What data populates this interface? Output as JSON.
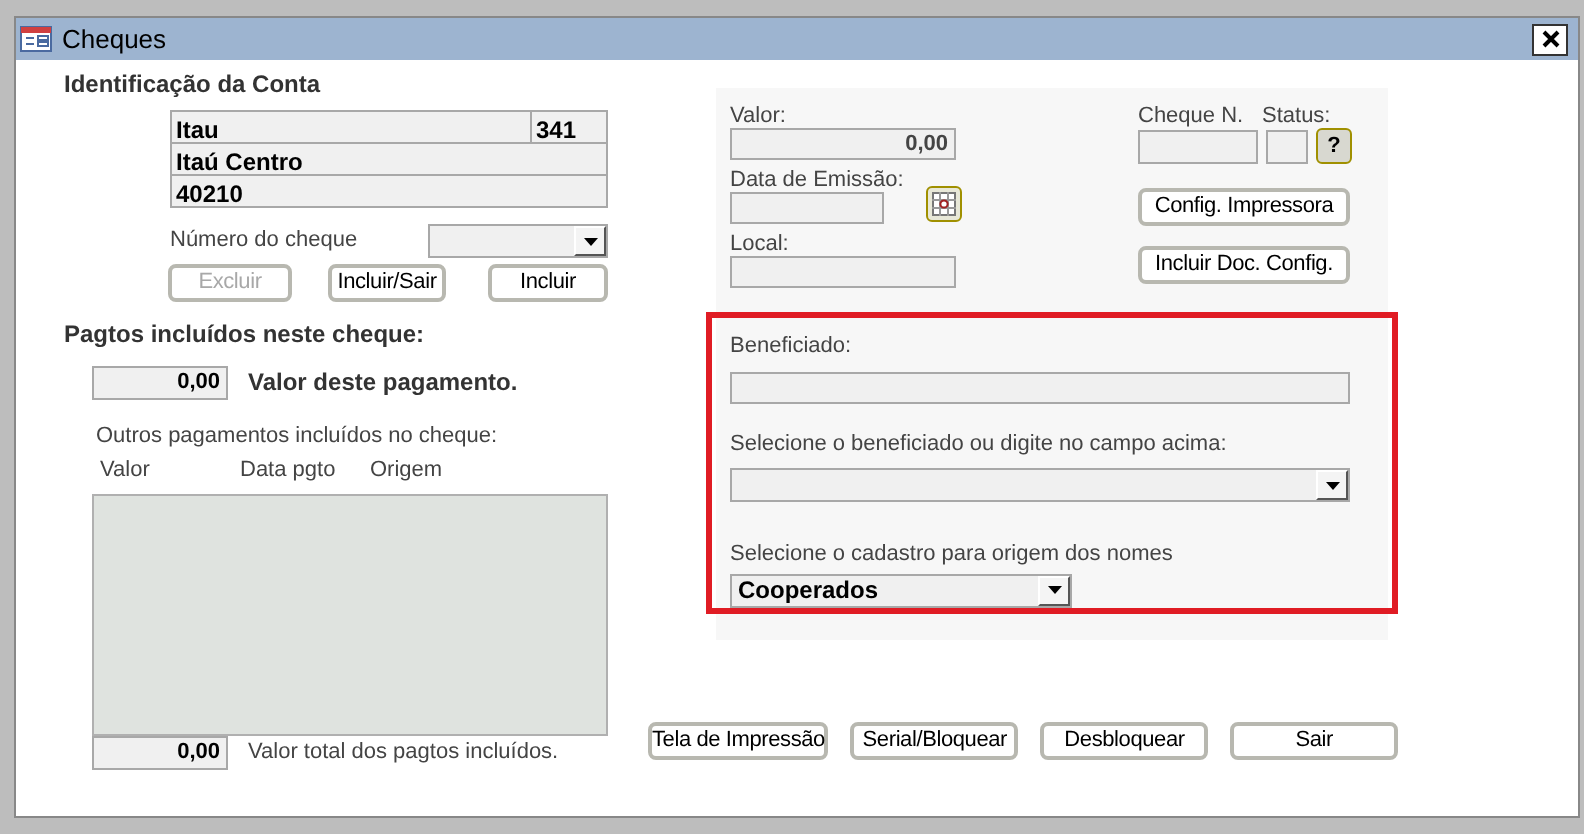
{
  "window": {
    "title": "Cheques"
  },
  "account": {
    "heading": "Identificação da Conta",
    "bank": "Itau",
    "bank_code": "341",
    "branch": "Itaú Centro",
    "account_number": "40210"
  },
  "check_number": {
    "label": "Número do cheque"
  },
  "left_buttons": [
    {
      "label": "Excluir",
      "disabled": true
    },
    {
      "label": "Incluir/Sair",
      "disabled": false
    },
    {
      "label": "Incluir",
      "disabled": false
    }
  ],
  "payments": {
    "heading": "Pagtos incluídos neste cheque:",
    "value": "0,00",
    "value_label": "Valor deste pagamento.",
    "others_label": "Outros pagamentos incluídos no cheque:",
    "columns": [
      "Valor",
      "Data pgto",
      "Origem"
    ],
    "total": "0,00",
    "total_label": "Valor total dos pagtos incluídos."
  },
  "details": {
    "value_label": "Valor:",
    "value": "0,00",
    "date_label": "Data de Emissão:",
    "place_label": "Local:",
    "check_no_label": "Cheque N.",
    "status_label": "Status:",
    "status_button": "?",
    "config_buttons": [
      "Config. Impressora",
      "Incluir Doc. Config."
    ]
  },
  "beneficiary": {
    "label": "Beneficiado:",
    "select_label": "Selecione o beneficiado ou digite no campo acima:",
    "source_label": "Selecione o cadastro para origem dos nomes",
    "source_value": "Cooperados"
  },
  "bottom_buttons": [
    "Tela de Impressão",
    "Serial/Bloquear",
    "Desbloquear",
    "Sair"
  ]
}
